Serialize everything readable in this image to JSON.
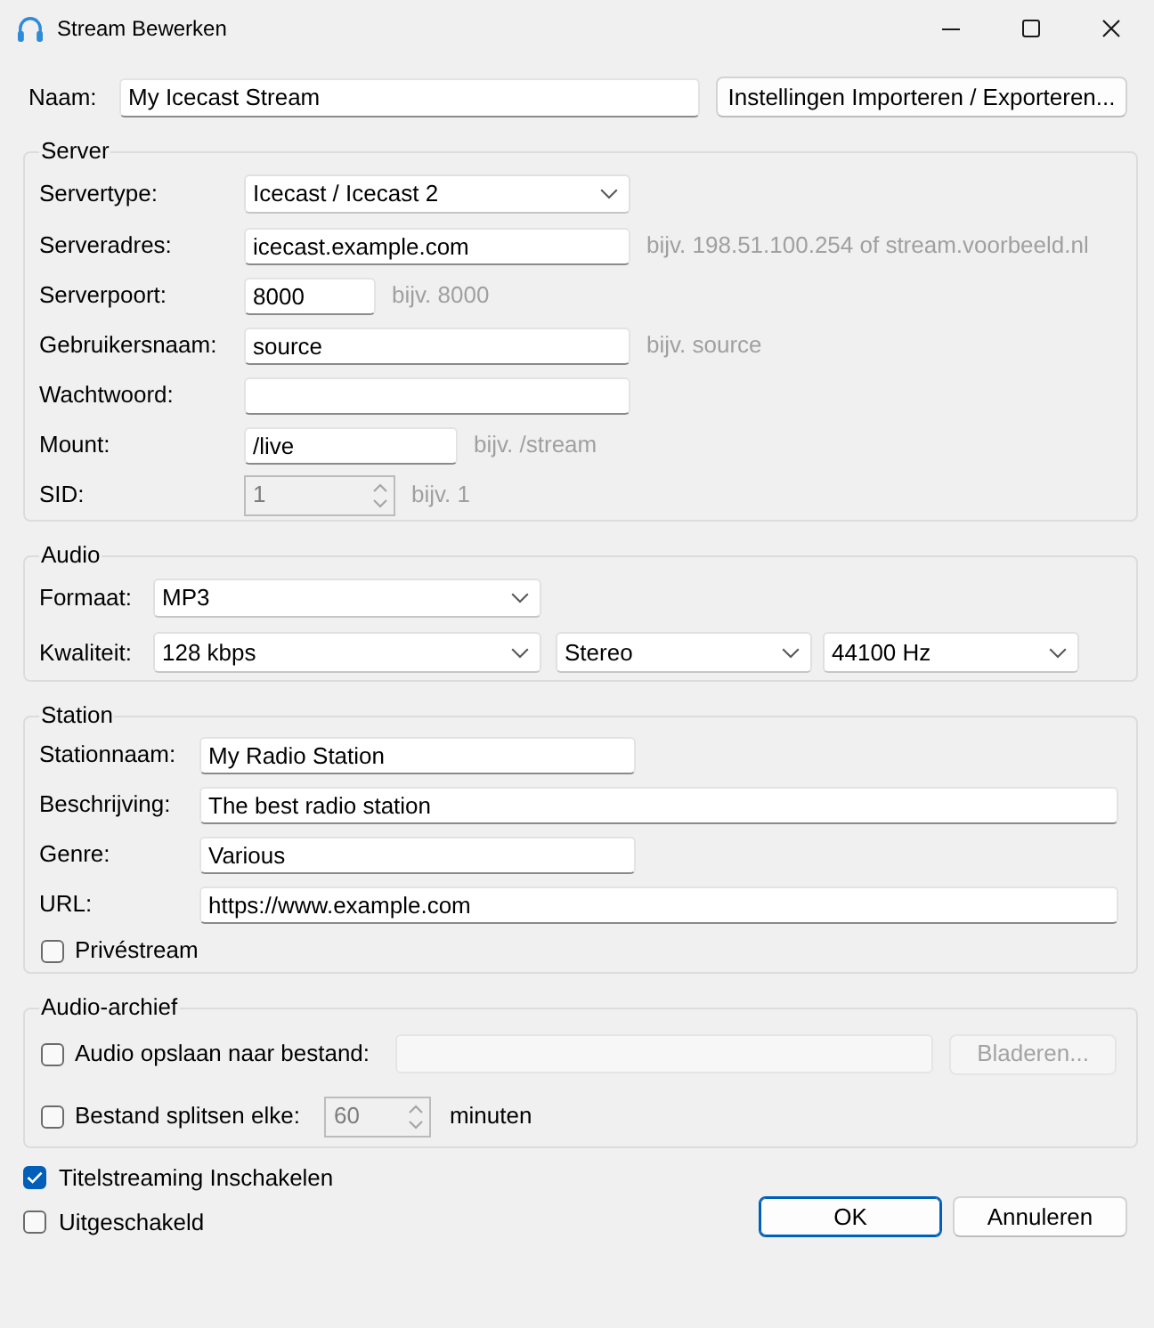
{
  "window": {
    "title": "Stream Bewerken"
  },
  "name": {
    "label": "Naam:",
    "value": "My Icecast Stream",
    "button": "Instellingen Importeren / Exporteren..."
  },
  "server": {
    "legend": "Server",
    "fields": [
      {
        "kind": "select",
        "label": "Servertype:",
        "value": "Icecast / Icecast 2"
      },
      {
        "kind": "text",
        "label": "Serveradres:",
        "value": "icecast.example.com",
        "hint": "bijv. 198.51.100.254 of stream.voorbeeld.nl"
      },
      {
        "kind": "text",
        "label": "Serverpoort:",
        "value": "8000",
        "hint": "bijv. 8000"
      },
      {
        "kind": "text",
        "label": "Gebruikersnaam:",
        "value": "source",
        "hint": "bijv. source"
      },
      {
        "kind": "text",
        "label": "Wachtwoord:"
      },
      {
        "kind": "text",
        "label": "Mount:",
        "value": "/live",
        "hint": "bijv. /stream"
      },
      {
        "kind": "spin",
        "label": "SID:",
        "value": "1",
        "disabled": true,
        "hint": "bijv. 1"
      }
    ]
  },
  "audio": {
    "legend": "Audio",
    "format": {
      "label": "Formaat:",
      "value": "MP3"
    },
    "quality": {
      "label": "Kwaliteit:",
      "dropdowns": [
        "128 kbps",
        "Stereo",
        "44100 Hz"
      ]
    }
  },
  "station": {
    "legend": "Station",
    "fields": [
      {
        "label": "Stationnaam:",
        "value": "My Radio Station"
      },
      {
        "label": "Beschrijving:",
        "value": "The best radio station"
      },
      {
        "label": "Genre:",
        "value": "Various"
      },
      {
        "label": "URL:",
        "value": "https://www.example.com"
      }
    ],
    "private": {
      "label": "Privéstream",
      "checked": false
    }
  },
  "archive": {
    "legend": "Audio-archief",
    "save": {
      "label": "Audio opslaan naar bestand:",
      "checked": false,
      "path": {
        "disabled": true
      },
      "browse": {
        "label": "Bladeren...",
        "disabled": true
      }
    },
    "split": {
      "label": "Bestand splitsen elke:",
      "checked": false,
      "value": "60",
      "disabled": true,
      "unit": "minuten"
    }
  },
  "options": [
    {
      "label": "Titelstreaming Inschakelen",
      "checked": true
    },
    {
      "label": "Uitgeschakeld",
      "checked": false
    }
  ],
  "buttons": [
    {
      "label": "OK",
      "default": true
    },
    {
      "label": "Annuleren",
      "default": false
    }
  ]
}
